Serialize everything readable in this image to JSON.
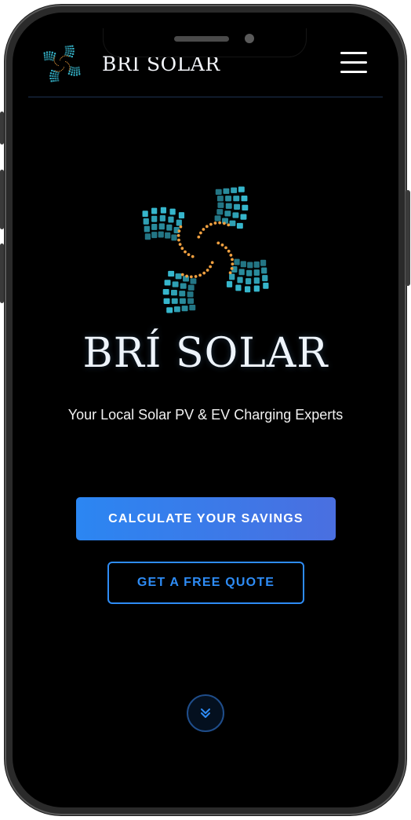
{
  "header": {
    "brand": "BRI SOLAR",
    "logo_icon": "solar-panel-swirl-icon",
    "menu_icon": "hamburger-menu-icon"
  },
  "hero": {
    "brand": "BRÍ SOLAR",
    "tagline": "Your Local Solar PV & EV Charging Experts",
    "primary_button": "CALCULATE YOUR SAVINGS",
    "secondary_button": "GET A FREE QUOTE",
    "scroll_icon": "double-chevron-down-icon"
  },
  "colors": {
    "background": "#000000",
    "accent_blue": "#2e8cf5",
    "primary_gradient_start": "#2b86f2",
    "primary_gradient_end": "#4a6fe0",
    "logo_cyan": "#3fd6f0",
    "logo_orange": "#f0a040"
  }
}
